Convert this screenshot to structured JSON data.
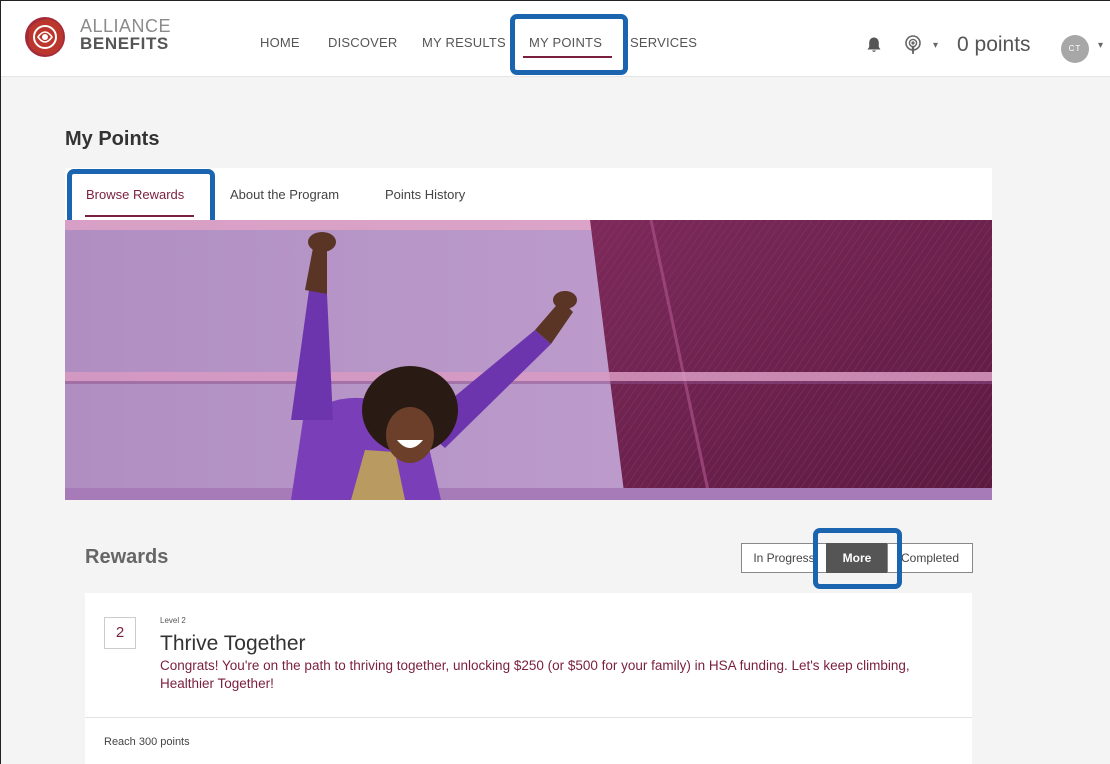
{
  "brand": {
    "line1": "ALLIANCE",
    "line2": "BENEFITS",
    "accent_color": "#7a1f3d",
    "highlight_color": "#1b64b0"
  },
  "nav": {
    "items": [
      {
        "label": "HOME"
      },
      {
        "label": "DISCOVER"
      },
      {
        "label": "MY RESULTS"
      },
      {
        "label": "MY POINTS",
        "active": true
      },
      {
        "label": "SERVICES"
      }
    ],
    "points": "0 points",
    "avatar_initials": "CT",
    "icons": [
      "bell-icon",
      "podcast-icon",
      "chevron-down-icon"
    ]
  },
  "page": {
    "title": "My Points",
    "tabs": [
      {
        "label": "Browse Rewards",
        "active": true
      },
      {
        "label": "About the Program"
      },
      {
        "label": "Points History"
      }
    ]
  },
  "rewards": {
    "heading": "Rewards",
    "filters": [
      {
        "label": "In Progress"
      },
      {
        "label": "More",
        "active": true
      },
      {
        "label": "Completed"
      }
    ],
    "card": {
      "level_number": "2",
      "level_label": "Level 2",
      "title": "Thrive Together",
      "description": "Congrats! You're on the path to thriving together, unlocking $250 (or $500 for your family) in HSA funding. Let's keep climbing, Healthier Together!",
      "requirement": "Reach 300 points"
    }
  }
}
